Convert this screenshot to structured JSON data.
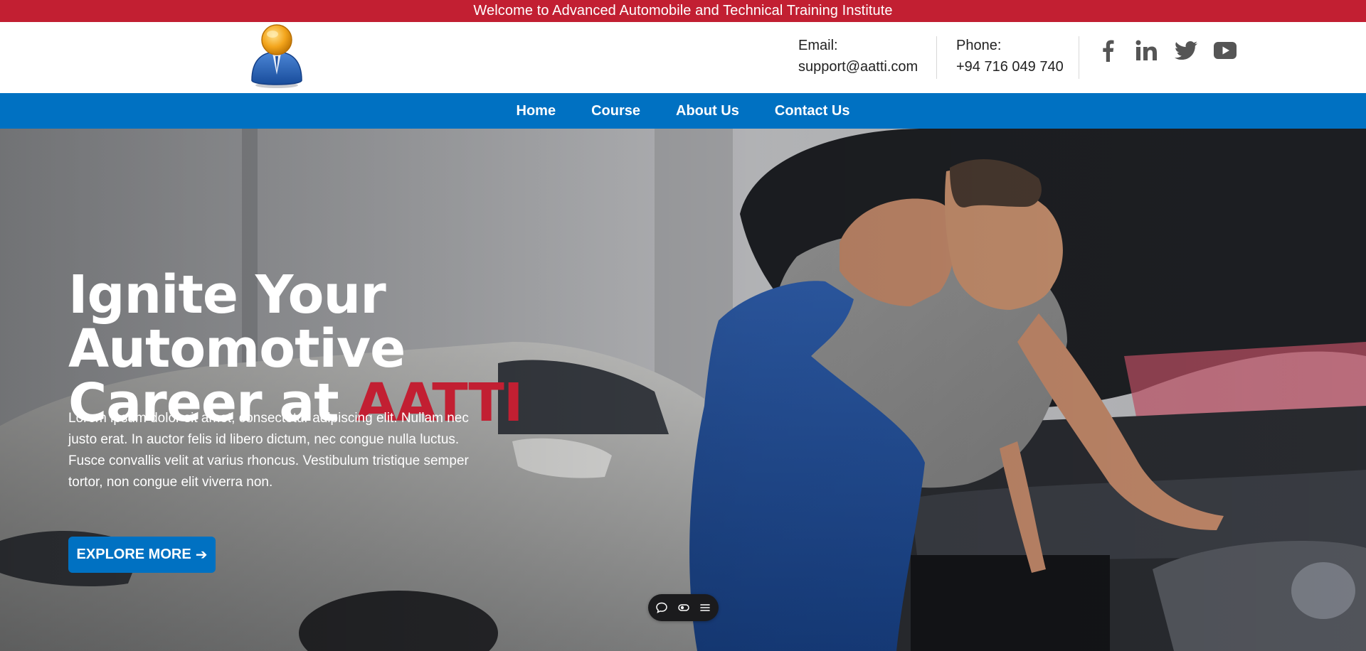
{
  "topbar": {
    "welcome_text": "Welcome to Advanced Automobile and Technical Training Institute"
  },
  "header": {
    "logo_icon": "user-avatar-logo-icon",
    "email_label": "Email:",
    "email_value": "support@aatti.com",
    "phone_label": "Phone:",
    "phone_value": "+94 716 049 740",
    "social": [
      "facebook-icon",
      "linkedin-icon",
      "twitter-icon",
      "youtube-icon"
    ]
  },
  "nav": {
    "items": [
      {
        "label": "Home"
      },
      {
        "label": "Course"
      },
      {
        "label": "About Us"
      },
      {
        "label": "Contact Us"
      }
    ]
  },
  "hero": {
    "title_line1": "Ignite Your Automotive",
    "title_line2_prefix": "Career at ",
    "title_accent": "AATTI",
    "paragraph": "Lorem ipsum dolor sit amet, consectetur adipiscing elit. Nullam nec justo erat. In auctor felis id libero dictum, nec congue nulla luctus. Fusce convallis velit at varius rhoncus. Vestibulum tristique semper tortor, non congue elit viverra non.",
    "cta_label": "EXPLORE MORE",
    "cta_arrow": "➔",
    "background": "mechanic-working-on-car-engine-image"
  },
  "floating_toolbar": {
    "icons": [
      "comment-icon",
      "toggle-icon",
      "menu-icon"
    ]
  },
  "colors": {
    "brand_red": "#c21f32",
    "brand_blue": "#0071c2",
    "white": "#ffffff"
  }
}
